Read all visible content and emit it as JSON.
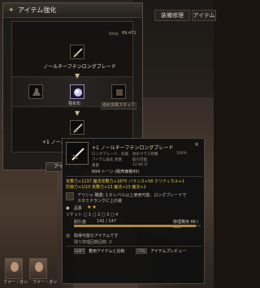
{
  "top_tabs": {
    "repair": "装備修理",
    "item": "アイテム"
  },
  "enhance": {
    "title": "アイテム強化",
    "money_label": "所持金",
    "money": "69,471",
    "weapon_name": "ノールチーフテンロングブレード",
    "stone_name": "強化石",
    "fail_stack_label": "強化失敗スタック",
    "result_name": "+1 ノールチーフテンロ",
    "enhance_button": "アイテム強化"
  },
  "tooltip": {
    "name": "+1 ノールチーフテンロングブレード",
    "type_label": "ロングブレード、武器",
    "type_value": "他のクラス装備",
    "status_label": "アイテム強化 状態",
    "status_value": "取引可能",
    "weight_label": "重量",
    "weight_value": "12.84 LT",
    "pct": "100%",
    "price": "NX4 トーン (販売価格45)",
    "stats_1": "攻撃力+1137 魔法攻撃力+1875 バランス+58 クリティカル+1",
    "stats_2": "防御力+1/10 攻撃力+13 魔法+13 魔法+2",
    "desc_1": "アリシャ 職業: 1 0 レベル以上使用可能、ロングブレードで",
    "desc_2": "スタミナランクに上の装",
    "grade_label": "品質",
    "stars": "★★",
    "sockets": "ソケット    □ 1  □ 2  □ 3  □ 4",
    "dura_label": "耐久度",
    "dura_value": "142 / 147",
    "dura_fill": 0.96,
    "repair": "修理費用 88 / 138",
    "compare": "取得可能なアイテムです",
    "remain": "残り修理回数回数: 3",
    "key1": "SHIFT",
    "action1": "着用アイテムと比較",
    "key2": "CTRL",
    "action2": "アイテムプレビュー"
  },
  "portraits": [
    {
      "name": "ファー・ガン"
    },
    {
      "name": "ファー・ガン"
    }
  ]
}
